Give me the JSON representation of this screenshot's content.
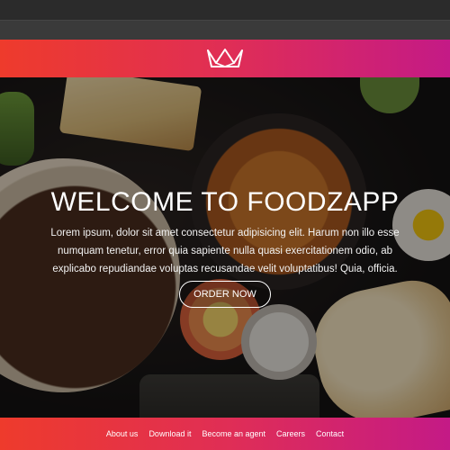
{
  "brand": {
    "logo_icon": "crown-icon"
  },
  "hero": {
    "title": "WELCOME TO FOODZAPP",
    "text": "Lorem ipsum, dolor sit amet consectetur adipisicing elit. Harum non illo esse numquam tenetur, error quia sapiente nulla quasi exercitationem odio, ab explicabo repudiandae voluptas recusandae velit voluptatibus! Quia, officia.",
    "order_button": "ORDER NOW"
  },
  "footer": {
    "links": [
      "About us",
      "Download it",
      "Become an agent",
      "Careers",
      "Contact"
    ]
  },
  "colors": {
    "gradient_start": "#ee3b2c",
    "gradient_mid": "#e02e55",
    "gradient_end": "#c41a86"
  }
}
